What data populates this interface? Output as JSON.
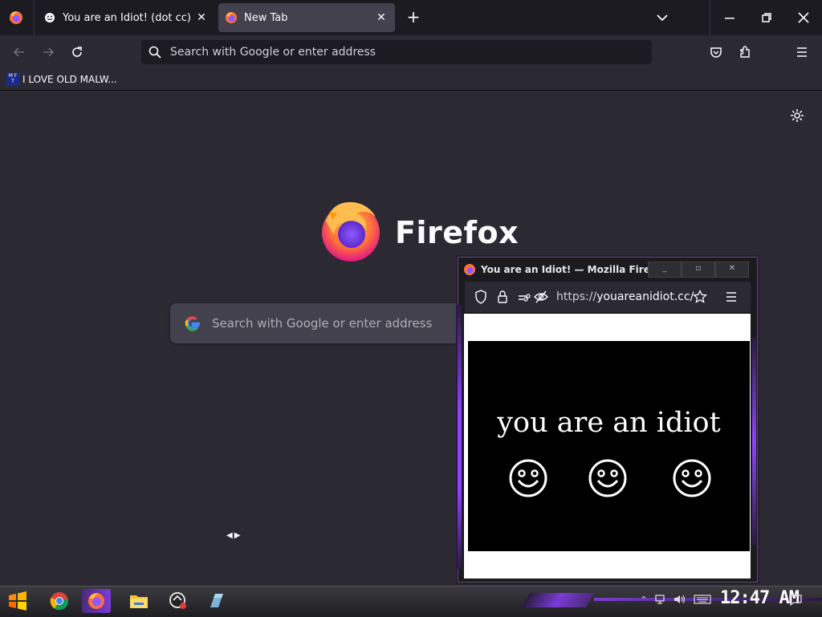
{
  "tabs": [
    {
      "title": "You are an Idiot! (dot cc)",
      "icon": "smiley-face-icon",
      "active": false
    },
    {
      "title": "New Tab",
      "icon": "firefox-icon",
      "active": true
    }
  ],
  "navbar": {
    "address_placeholder": "Search with Google or enter address"
  },
  "bookmarks": [
    {
      "label": "I LOVE OLD MALW...",
      "icon_text": "MF T"
    }
  ],
  "newtab": {
    "wordmark": "Firefox",
    "search_placeholder": "Search with Google or enter address"
  },
  "popup": {
    "title": "You are an Idiot! — Mozilla Fire...",
    "url_scheme": "https://",
    "url_host": "youareanidiot.cc/",
    "message": "you are an idiot",
    "smiley_count": 3
  },
  "taskbar": {
    "clock": "12:47 AM",
    "apps": [
      "start-icon",
      "chrome-icon",
      "firefox-icon",
      "file-explorer-icon",
      "app-icon",
      "app-icon"
    ]
  },
  "colors": {
    "chrome_bg": "#1c1b22",
    "toolbar_bg": "#2b2a33",
    "active_tab": "#42414d",
    "accent_purple": "#7a3bd6"
  }
}
